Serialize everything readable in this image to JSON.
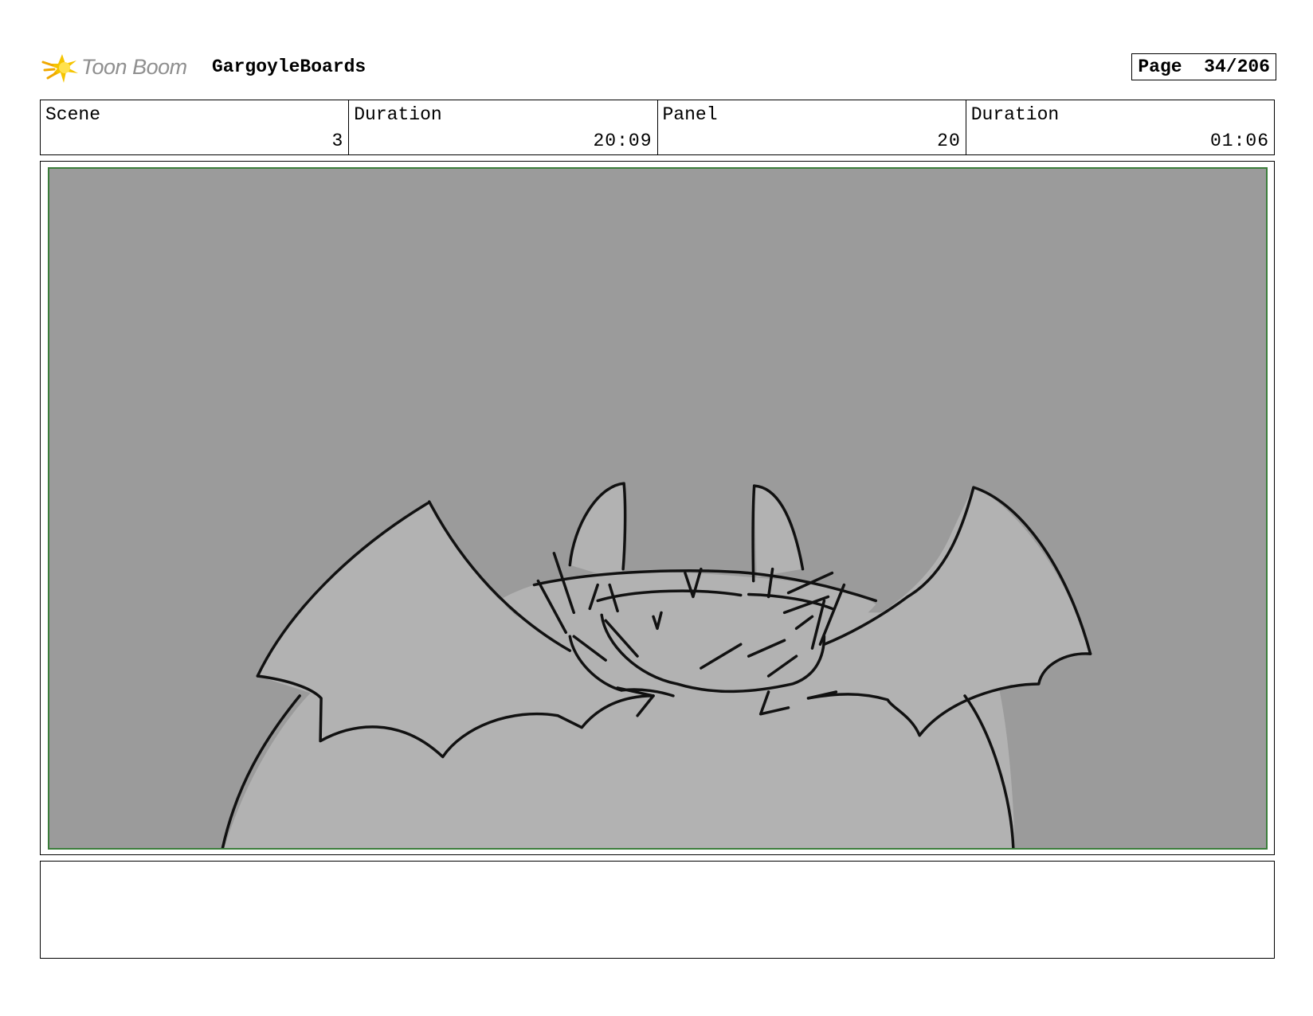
{
  "header": {
    "logo_text": "Toon Boom",
    "project_name": "GargoyleBoards",
    "page_label": "Page",
    "page_number": "34/206"
  },
  "info": [
    {
      "label": "Scene",
      "value": "3"
    },
    {
      "label": "Duration",
      "value": "20:09"
    },
    {
      "label": "Panel",
      "value": "20"
    },
    {
      "label": "Duration",
      "value": "01:06"
    }
  ],
  "notes": "",
  "colors": {
    "panel_background": "#9b9b9b",
    "figure_fill": "#b2b2b2",
    "safe_frame": "#3a7d3a",
    "logo_yellow": "#f5c400"
  }
}
